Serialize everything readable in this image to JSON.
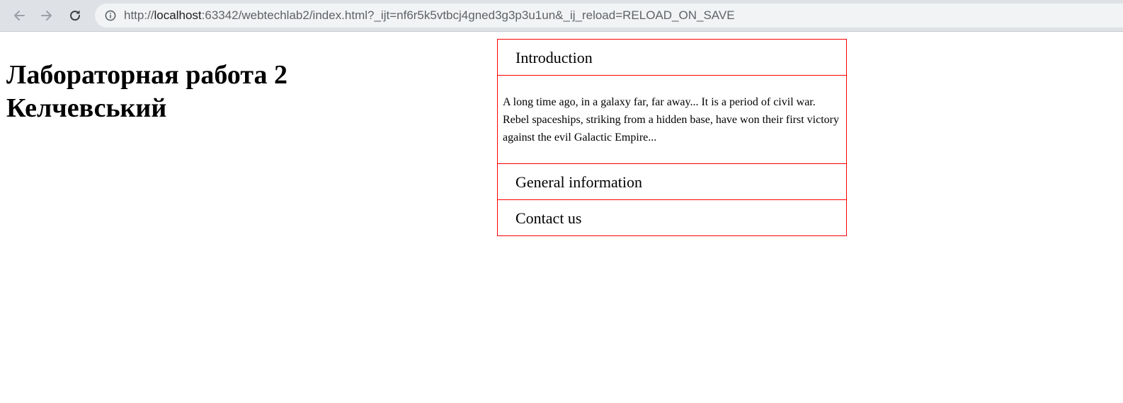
{
  "browser": {
    "url_prefix": "http://",
    "url_host": "localhost",
    "url_rest": ":63342/webtechlab2/index.html?_ijt=nf6r5k5vtbcj4gned3g3p3u1un&_ij_reload=RELOAD_ON_SAVE",
    "icons": {
      "back": "arrow-left-icon",
      "forward": "arrow-right-icon",
      "reload": "reload-icon",
      "info": "info-icon"
    }
  },
  "page": {
    "title_line1": "Лабораторная работа 2",
    "title_line2": "Келчевський"
  },
  "accordion": {
    "border_color": "#ff0000",
    "sections": [
      {
        "label": "Introduction",
        "expanded": true,
        "content": "A long time ago, in a galaxy far, far away... It is a period of civil war. Rebel spaceships, striking from a hidden base, have won their first victory against the evil Galactic Empire..."
      },
      {
        "label": "General information",
        "expanded": false
      },
      {
        "label": "Contact us",
        "expanded": false
      }
    ]
  }
}
